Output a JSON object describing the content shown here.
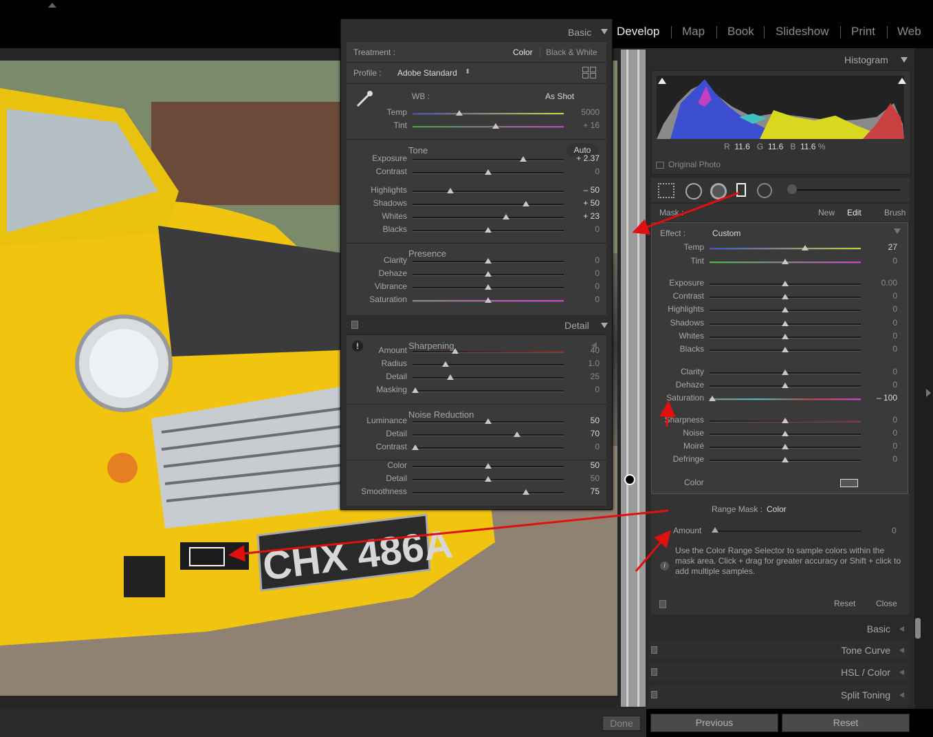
{
  "modules": [
    "Develop",
    "Map",
    "Book",
    "Slideshow",
    "Print",
    "Web"
  ],
  "active_module": "Develop",
  "floating": {
    "basic_title": "Basic",
    "treatment_label": "Treatment :",
    "treatment_color": "Color",
    "treatment_bw": "Black & White",
    "profile_label": "Profile :",
    "profile_value": "Adobe Standard",
    "wb_label": "WB :",
    "wb_value": "As Shot",
    "tone_label": "Tone",
    "auto_label": "Auto",
    "presence_label": "Presence",
    "detail_title": "Detail",
    "sharpening_label": "Sharpening",
    "noise_label": "Noise Reduction",
    "rows": [
      {
        "label": "Temp",
        "value": "5000",
        "pos": 0.31,
        "dim": true
      },
      {
        "label": "Tint",
        "value": "+ 16",
        "pos": 0.55,
        "dim": true
      },
      {
        "label": "Exposure",
        "value": "+ 2.37",
        "pos": 0.73,
        "dim": false
      },
      {
        "label": "Contrast",
        "value": "0",
        "pos": 0.5,
        "dim": true
      },
      {
        "label": "Highlights",
        "value": "– 50",
        "pos": 0.25,
        "dim": false
      },
      {
        "label": "Shadows",
        "value": "+ 50",
        "pos": 0.75,
        "dim": false
      },
      {
        "label": "Whites",
        "value": "+ 23",
        "pos": 0.62,
        "dim": false
      },
      {
        "label": "Blacks",
        "value": "0",
        "pos": 0.5,
        "dim": true
      },
      {
        "label": "Clarity",
        "value": "0",
        "pos": 0.5,
        "dim": true
      },
      {
        "label": "Dehaze",
        "value": "0",
        "pos": 0.5,
        "dim": true
      },
      {
        "label": "Vibrance",
        "value": "0",
        "pos": 0.5,
        "dim": true
      },
      {
        "label": "Saturation",
        "value": "0",
        "pos": 0.5,
        "dim": true
      },
      {
        "label": "Amount",
        "value": "40",
        "pos": 0.28,
        "dim": true
      },
      {
        "label": "Radius",
        "value": "1.0",
        "pos": 0.22,
        "dim": true
      },
      {
        "label": "Detail",
        "value": "25",
        "pos": 0.25,
        "dim": true
      },
      {
        "label": "Masking",
        "value": "0",
        "pos": 0.02,
        "dim": true
      },
      {
        "label": "Luminance",
        "value": "50",
        "pos": 0.5,
        "dim": false
      },
      {
        "label": "Detail",
        "value": "70",
        "pos": 0.69,
        "dim": false
      },
      {
        "label": "Contrast",
        "value": "0",
        "pos": 0.02,
        "dim": true
      },
      {
        "label": "Color",
        "value": "50",
        "pos": 0.5,
        "dim": false
      },
      {
        "label": "Detail",
        "value": "50",
        "pos": 0.5,
        "dim": true
      },
      {
        "label": "Smoothness",
        "value": "75",
        "pos": 0.75,
        "dim": false
      }
    ]
  },
  "right": {
    "histogram_title": "Histogram",
    "rgb": {
      "r_label": "R",
      "r": "11.6",
      "g_label": "G",
      "g": "11.6",
      "b_label": "B",
      "b": "11.6",
      "pct": "%"
    },
    "original_photo": "Original Photo",
    "mask_label": "Mask :",
    "mask_new": "New",
    "mask_edit": "Edit",
    "mask_brush": "Brush",
    "effect_label": "Effect :",
    "effect_value": "Custom",
    "rows": [
      {
        "label": "Temp",
        "value": "27",
        "pos": 0.63,
        "dim": false
      },
      {
        "label": "Tint",
        "value": "0",
        "pos": 0.5,
        "dim": true
      },
      {
        "label": "Exposure",
        "value": "0.00",
        "pos": 0.5,
        "dim": true
      },
      {
        "label": "Contrast",
        "value": "0",
        "pos": 0.5,
        "dim": true
      },
      {
        "label": "Highlights",
        "value": "0",
        "pos": 0.5,
        "dim": true
      },
      {
        "label": "Shadows",
        "value": "0",
        "pos": 0.5,
        "dim": true
      },
      {
        "label": "Whites",
        "value": "0",
        "pos": 0.5,
        "dim": true
      },
      {
        "label": "Blacks",
        "value": "0",
        "pos": 0.5,
        "dim": true
      },
      {
        "label": "Clarity",
        "value": "0",
        "pos": 0.5,
        "dim": true
      },
      {
        "label": "Dehaze",
        "value": "0",
        "pos": 0.5,
        "dim": true
      },
      {
        "label": "Saturation",
        "value": "– 100",
        "pos": 0.02,
        "dim": false
      },
      {
        "label": "Sharpness",
        "value": "0",
        "pos": 0.5,
        "dim": true
      },
      {
        "label": "Noise",
        "value": "0",
        "pos": 0.5,
        "dim": true
      },
      {
        "label": "Moiré",
        "value": "0",
        "pos": 0.5,
        "dim": true
      },
      {
        "label": "Defringe",
        "value": "0",
        "pos": 0.5,
        "dim": true
      }
    ],
    "color_label": "Color",
    "range_mask_label": "Range Mask :",
    "range_mask_value": "Color",
    "amount_label": "Amount",
    "amount_value": "0",
    "help_text": "Use the Color Range Selector to sample colors within the mask area. Click + drag for greater accuracy or Shift + click to add multiple samples.",
    "reset": "Reset",
    "close": "Close",
    "panels": [
      "Basic",
      "Tone Curve",
      "HSL / Color",
      "Split Toning"
    ],
    "previous_button": "Previous",
    "reset_button": "Reset"
  },
  "plate_text": "CHX 486A",
  "done_button": "Done"
}
